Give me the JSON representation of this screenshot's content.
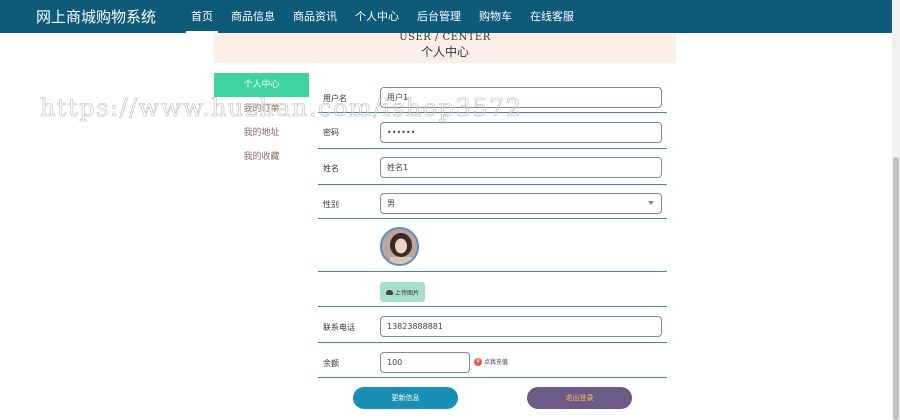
{
  "header": {
    "brand": "网上商城购物系统",
    "nav": [
      "首页",
      "商品信息",
      "商品资讯",
      "个人中心",
      "后台管理",
      "购物车",
      "在线客服"
    ],
    "active_index": 0
  },
  "banner": {
    "en": "USER / CENTER",
    "zh": "个人中心"
  },
  "sidebar": {
    "items": [
      "个人中心",
      "我的订单",
      "我的地址",
      "我的收藏"
    ],
    "active_index": 0
  },
  "form": {
    "username_label": "用户名",
    "username_value": "用户1",
    "password_label": "密码",
    "password_value": "••••••",
    "name_label": "姓名",
    "name_value": "姓名1",
    "gender_label": "性别",
    "gender_value": "男",
    "upload_label": "上传图片",
    "phone_label": "联系电话",
    "phone_value": "13823888881",
    "balance_label": "余额",
    "balance_value": "100",
    "recharge_label": "点我充值"
  },
  "actions": {
    "update": "更新信息",
    "logout": "退出登录"
  },
  "watermark": "https://www.huzhan.com/ishop3572",
  "colors": {
    "nav": "#0d5b79",
    "active_side": "#3fd3a1",
    "update": "#1a8fb4",
    "logout": "#6e5a86"
  }
}
